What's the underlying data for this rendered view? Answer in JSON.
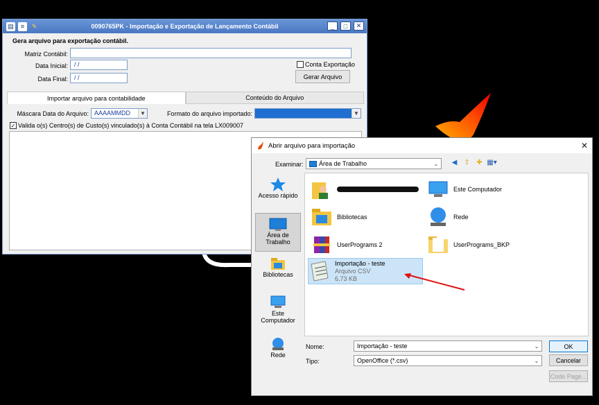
{
  "main_window": {
    "title": "0090765PK - Importação e Exportação de Lançamento Contábil",
    "section_title": "Gera arquivo para exportação contábil.",
    "labels": {
      "matriz": "Matriz Contábil:",
      "data_inicial": "Data Inicial:",
      "data_final": "Data Final:"
    },
    "values": {
      "matriz": "",
      "data_inicial": "/ /",
      "data_final": "/ /"
    },
    "conta_exportacao": {
      "label": "Conta Exportação",
      "checked": false
    },
    "gerar_button": "Gerar Arquivo",
    "tabs": [
      {
        "label": "Importar arquivo para contabilidade",
        "active": true
      },
      {
        "label": "Conteúdo do Arquivo",
        "active": false
      }
    ],
    "mascara": {
      "label": "Máscara Data do Arquivo:",
      "value": "AAAAMMDD"
    },
    "formato": {
      "label": "Formato do arquivo importado:",
      "value": ""
    },
    "valida": {
      "label": "Valida o(s) Centro(s) de Custo(s) vinculado(s) à Conta Contábil na tela LX009007",
      "checked": true
    }
  },
  "dialog": {
    "title": "Abrir arquivo para importação",
    "look_in_label": "Examinar:",
    "look_in_value": "Área de Trabalho",
    "places": [
      {
        "label": "Acesso rápido",
        "icon": "star-icon"
      },
      {
        "label": "Área de Trabalho",
        "icon": "desktop-icon",
        "selected": true
      },
      {
        "label": "Bibliotecas",
        "icon": "libraries-icon"
      },
      {
        "label": "Este Computador",
        "icon": "computer-icon"
      },
      {
        "label": "Rede",
        "icon": "network-icon"
      }
    ],
    "files": [
      {
        "name": "",
        "icon": "user-folder-icon",
        "redacted": true
      },
      {
        "name": "Este Computador",
        "icon": "computer-icon"
      },
      {
        "name": "Bibliotecas",
        "icon": "libraries-icon"
      },
      {
        "name": "Rede",
        "icon": "network-icon"
      },
      {
        "name": "UserPrograms 2",
        "icon": "winrar-icon"
      },
      {
        "name": "UserPrograms_BKP",
        "icon": "folder-icon"
      },
      {
        "name": "Importação - teste",
        "type": "Arquivo CSV",
        "size": "6,73 KB",
        "icon": "csv-file-icon",
        "selected": true
      }
    ],
    "file_name_label": "Nome:",
    "file_name_value": "Importação - teste",
    "file_type_label": "Tipo:",
    "file_type_value": "OpenOffice (*.csv)",
    "ok_button": "OK",
    "cancel_button": "Cancelar",
    "code_page_button": "Code Page..."
  }
}
